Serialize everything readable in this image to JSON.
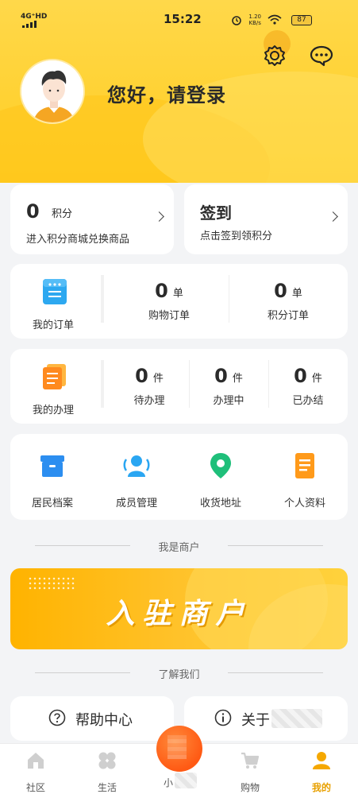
{
  "status_bar": {
    "network": "4G⁺HD",
    "time": "15:22",
    "speed": "1.20",
    "speed_unit": "KB/s",
    "battery": "87"
  },
  "header": {
    "greeting": "您好，请登录"
  },
  "points_card": {
    "count": "0",
    "unit": "积分",
    "subtitle": "进入积分商城兑换商品"
  },
  "sign_card": {
    "title": "签到",
    "subtitle": "点击签到领积分"
  },
  "orders": {
    "label": "我的订单",
    "stats": [
      {
        "count": "0",
        "unit": "单",
        "label": "购物订单"
      },
      {
        "count": "0",
        "unit": "单",
        "label": "积分订单"
      }
    ]
  },
  "handling": {
    "label": "我的办理",
    "stats": [
      {
        "count": "0",
        "unit": "件",
        "label": "待办理"
      },
      {
        "count": "0",
        "unit": "件",
        "label": "办理中"
      },
      {
        "count": "0",
        "unit": "件",
        "label": "已办结"
      }
    ]
  },
  "tools": [
    {
      "label": "居民档案",
      "icon": "archive-icon"
    },
    {
      "label": "成员管理",
      "icon": "members-icon"
    },
    {
      "label": "收货地址",
      "icon": "location-pin-icon"
    },
    {
      "label": "个人资料",
      "icon": "profile-doc-icon"
    }
  ],
  "merchant_section": {
    "title": "我是商户",
    "banner_text": "入驻商户"
  },
  "about_section": {
    "title": "了解我们"
  },
  "help": {
    "label": "帮助中心"
  },
  "about": {
    "label": "关于"
  },
  "tabs": [
    {
      "label": "社区",
      "icon": "house-icon"
    },
    {
      "label": "生活",
      "icon": "clover-icon"
    },
    {
      "label": "小",
      "icon": "center-logo-icon"
    },
    {
      "label": "购物",
      "icon": "cart-icon"
    },
    {
      "label": "我的",
      "icon": "person-icon"
    }
  ],
  "colors": {
    "accent": "#ffcc22",
    "active_tab": "#e8a000",
    "banner": "#ffb300"
  }
}
